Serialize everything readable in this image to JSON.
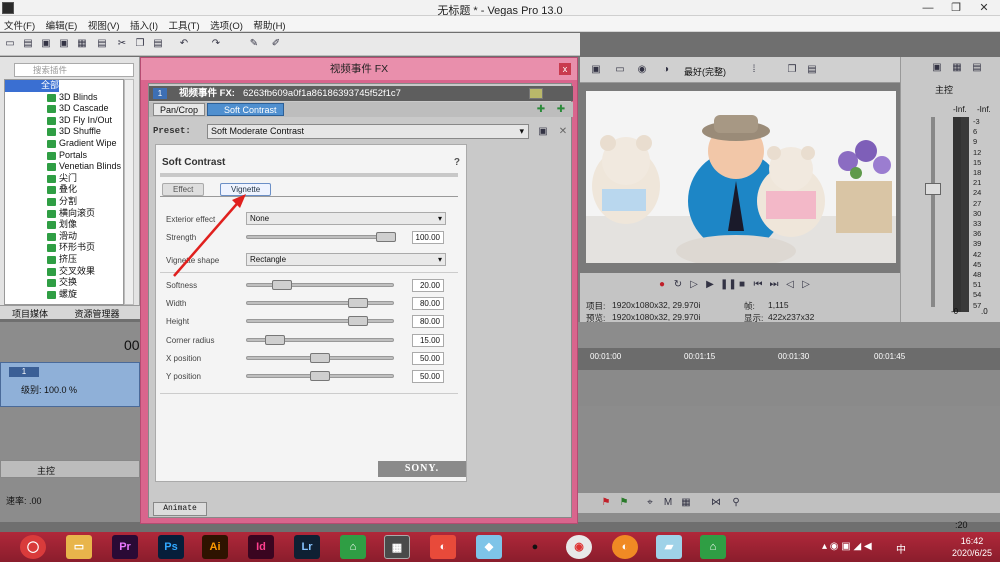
{
  "window": {
    "title": "无标题 * - Vegas Pro 13.0",
    "min": "—",
    "max": "❐",
    "close": "✕"
  },
  "menu": [
    "文件(F)",
    "编辑(E)",
    "视图(V)",
    "插入(I)",
    "工具(T)",
    "选项(O)",
    "帮助(H)"
  ],
  "plugins": {
    "search_placeholder": "搜索插件",
    "root": "全部",
    "items": [
      "3D Blinds",
      "3D Cascade",
      "3D Fly In/Out",
      "3D Shuffle",
      "Gradient Wipe",
      "Portals",
      "Venetian Blinds",
      "尖门",
      "叠化",
      "分割",
      "横向滚页",
      "划像",
      "滑动",
      "环形书页",
      "挤压",
      "交叉效果",
      "交换",
      "螺旋"
    ],
    "tabs": [
      "项目媒体",
      "资源管理器"
    ]
  },
  "fx_window": {
    "title": "视频事件 FX",
    "close": "x",
    "event_label": "视频事件 FX:",
    "event_id": "6263fb609a0f1a86186393745f52f1c7",
    "chain": [
      "Pan/Crop",
      "Soft Contrast"
    ],
    "preset_label": "Preset:",
    "preset_value": "Soft Moderate Contrast",
    "animate": "Animate"
  },
  "plugin_ui": {
    "title": "Soft Contrast",
    "help": "?",
    "tabs": [
      "Effect",
      "Vignette"
    ],
    "exterior_label": "Exterior effect",
    "exterior_value": "None",
    "strength_label": "Strength",
    "strength_value": "100.00",
    "shape_label": "Vignette shape",
    "shape_value": "Rectangle",
    "sliders": [
      {
        "label": "Softness",
        "value": "20.00",
        "pos": 0.2
      },
      {
        "label": "Width",
        "value": "80.00",
        "pos": 0.8
      },
      {
        "label": "Height",
        "value": "80.00",
        "pos": 0.8
      },
      {
        "label": "Corner radius",
        "value": "15.00",
        "pos": 0.15
      },
      {
        "label": "X position",
        "value": "50.00",
        "pos": 0.5
      },
      {
        "label": "Y position",
        "value": "50.00",
        "pos": 0.5
      }
    ],
    "strength_pos": 1.0,
    "brand": "SONY."
  },
  "preview": {
    "quality": "最好(完整)",
    "project_label": "项目:",
    "project_value": "1920x1080x32, 29.970i",
    "preview_label": "预览:",
    "preview_value": "1920x1080x32, 29.970i",
    "frame_label": "帧:",
    "frame_value": "1,115",
    "display_label": "显示:",
    "display_value": "422x237x32"
  },
  "master": {
    "label": "主控",
    "scale": [
      "-3",
      "6",
      "9",
      "12",
      "15",
      "18",
      "21",
      "24",
      "27",
      "30",
      "33",
      "36",
      "39",
      "42",
      "45",
      "48",
      "51",
      "54",
      "57"
    ],
    "top_left": "-Inf.",
    "top_right": "-Inf.",
    "bot_left": "-0",
    "bot_right": ".0"
  },
  "timeline": {
    "time": "00",
    "track_level": "级别: 100.0 %",
    "track_num": "1",
    "bus_label": "主控",
    "rate": "速率: .00",
    "ruler": [
      "00:01:00",
      "00:01:15",
      "00:01:30",
      "00:01:45"
    ],
    "end_time": ":20"
  },
  "taskbar": {
    "apps": [
      "Pr",
      "Ps",
      "Ai",
      "Id",
      "Lr"
    ],
    "time": "16:42",
    "date": "2020/6/25",
    "ime": "中"
  }
}
